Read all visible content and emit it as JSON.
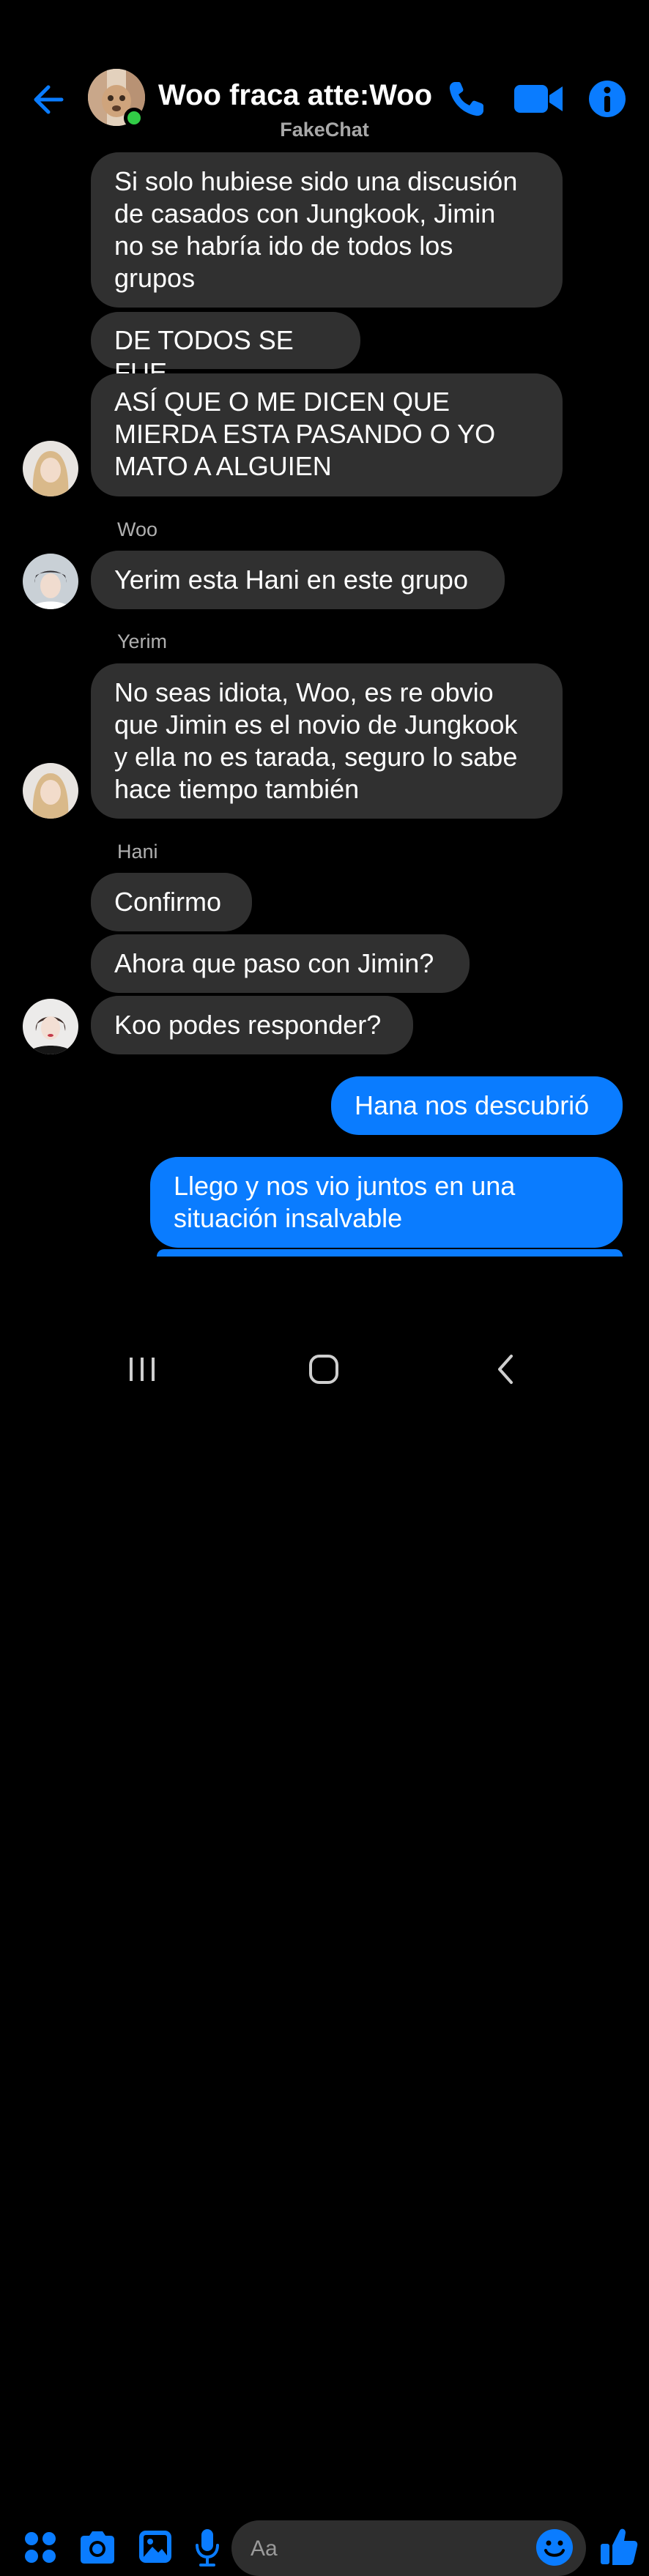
{
  "header": {
    "title": "Woo fraca atte:Woo",
    "subtitle": "FakeChat",
    "icons": [
      "back-arrow-icon",
      "phone-icon",
      "video-camera-icon",
      "info-icon"
    ]
  },
  "messages": [
    {
      "text_lines": [
        "Si solo hubiese sido una discusión",
        "de casados con Jungkook, Jimin",
        "no se habría ido de todos los",
        "grupos"
      ]
    },
    {
      "text_lines": [
        "DE TODOS SE FUE"
      ]
    },
    {
      "text_lines": [
        "ASÍ QUE O ME DICEN QUE",
        "MIERDA ESTA PASANDO O YO",
        "MATO A ALGUIEN"
      ]
    },
    {
      "sender": "Woo",
      "text_lines": [
        "Yerim esta Hani en este grupo"
      ]
    },
    {
      "sender": "Yerim",
      "text_lines": [
        "No seas idiota, Woo, es re obvio",
        "que Jimin es el novio de Jungkook",
        "y ella no es tarada, seguro lo sabe",
        "hace tiempo también"
      ]
    },
    {
      "sender": "Hani",
      "text_lines": [
        "Confirmo"
      ]
    },
    {
      "text_lines": [
        "Ahora que paso con Jimin?"
      ]
    },
    {
      "text_lines": [
        "Koo podes responder?"
      ]
    },
    {
      "text_lines": [
        "Hana nos descubrió"
      ]
    },
    {
      "text_lines": [
        "Llego y nos vio juntos en una",
        "situación insalvable"
      ]
    }
  ],
  "composer": {
    "placeholder": "Aa",
    "icons": [
      "apps-icon",
      "camera-icon",
      "gallery-icon",
      "microphone-icon",
      "emoji-icon",
      "like-icon"
    ]
  },
  "colors": {
    "accent": "#0a7cff",
    "incoming_bubble": "#303030",
    "background": "#000000"
  }
}
